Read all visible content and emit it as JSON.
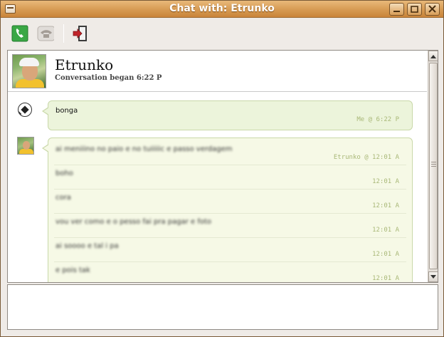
{
  "window": {
    "title": "Chat with: Etrunko"
  },
  "toolbar": {
    "call_icon": "phone-call-icon",
    "hangup_icon": "phone-hangup-icon",
    "leave_icon": "leave-chat-icon"
  },
  "header": {
    "contact_name": "Etrunko",
    "conversation_began": "Conversation began 6:22 P"
  },
  "messages": {
    "me": {
      "text": "bonga",
      "time": "Me @ 6:22 P"
    },
    "them": [
      {
        "text": "ai meniiino no paio e no tuiiiiic e passo verdagem",
        "time": "Etrunko @ 12:01 A"
      },
      {
        "text": "boho",
        "time": "12:01 A"
      },
      {
        "text": "cora",
        "time": "12:01 A"
      },
      {
        "text": "vou ver como e o pesso fai pra pagar e foto",
        "time": "12:01 A"
      },
      {
        "text": "ai soooo e tal i pa",
        "time": "12:01 A"
      },
      {
        "text": "e pois tak",
        "time": "12:01 A"
      }
    ]
  },
  "colors": {
    "titlebar": "#d69a52",
    "bubble_me": "#ecf4db",
    "bubble_them": "#f6f9e6",
    "timestamp": "#a9b878"
  }
}
